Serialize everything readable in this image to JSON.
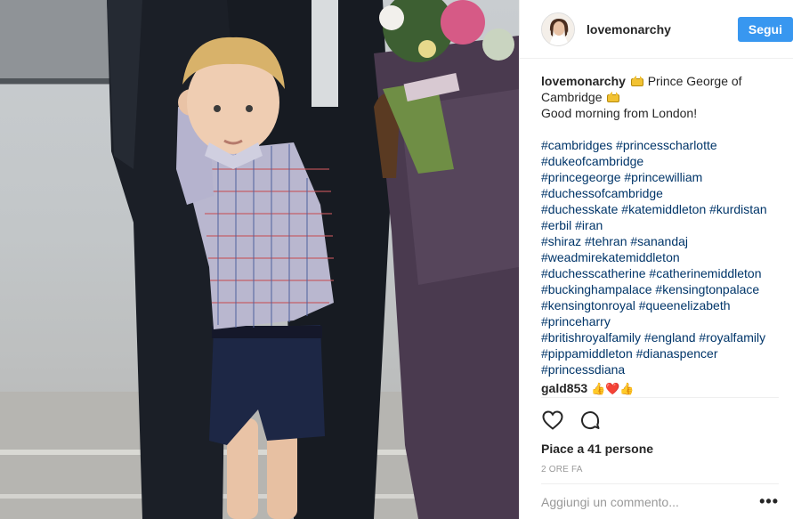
{
  "post": {
    "photo_alt": "Prince George",
    "username": "lovemonarchy",
    "follow_label": "Segui",
    "caption": {
      "user": "lovemonarchy",
      "text_line1": "Prince George of",
      "text_line2": "Cambridge",
      "text_line3": "Good morning from London!"
    },
    "hashtags": [
      "#cambridges #princesscharlotte",
      "#dukeofcambridge",
      "#princegeorge #princewilliam",
      "#duchessofcambridge",
      "#duchesskate #katemiddleton #kurdistan",
      "#erbil #iran",
      "#shiraz #tehran #sanandaj",
      "#weadmirekatemiddleton",
      "#duchesscatherine #catherinemiddleton",
      "#buckinghampalace #kensingtonpalace",
      "#kensingtonroyal #queenelizabeth",
      "#princeharry",
      "#britishroyalfamily #england #royalfamily",
      "#pippamiddleton #dianaspencer",
      "#princessdiana"
    ],
    "comment": {
      "user": "gald853",
      "emojis": "👍❤️👍"
    },
    "likes_text": "Piace a 41 persone",
    "timestamp": "2 ORE FA",
    "comment_placeholder": "Aggiungi un commento...",
    "more_label": "•••"
  },
  "colors": {
    "follow_button": "#3897f0",
    "hashtag": "#003569",
    "text": "#262626",
    "muted": "#999999"
  },
  "icons": [
    "heart-icon",
    "comment-icon",
    "crown-icon",
    "more-options-icon"
  ]
}
